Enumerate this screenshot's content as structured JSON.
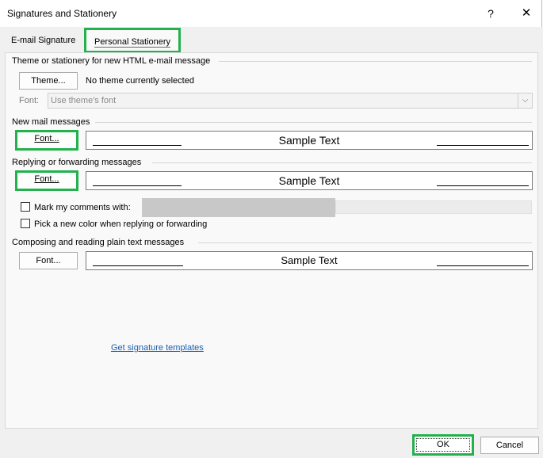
{
  "window": {
    "title": "Signatures and Stationery",
    "help_label": "?",
    "close_label": "✕"
  },
  "tabs": {
    "email_signature": "E-mail Signature",
    "personal_stationery": "Personal Stationery"
  },
  "theme_section": {
    "label": "Theme or stationery for new HTML e-mail message",
    "theme_button": "Theme...",
    "theme_status": "No theme currently selected",
    "font_label": "Font:",
    "font_select_value": "Use theme's font"
  },
  "new_mail": {
    "label": "New mail messages",
    "font_button": "Font...",
    "sample_text": "Sample Text"
  },
  "reply_forward": {
    "label": "Replying or forwarding messages",
    "font_button": "Font...",
    "sample_text": "Sample Text",
    "mark_comments_label": "Mark my comments with:",
    "mark_comments_checked": false,
    "pick_color_label": "Pick a new color when replying or forwarding",
    "pick_color_checked": false
  },
  "plain_text": {
    "label": "Composing and reading plain text messages",
    "font_button": "Font...",
    "sample_text": "Sample Text"
  },
  "links": {
    "signature_templates": "Get signature templates"
  },
  "footer": {
    "ok_label": "OK",
    "cancel_label": "Cancel"
  },
  "colors": {
    "highlight": "#22b14c",
    "link": "#1a5fb4"
  }
}
